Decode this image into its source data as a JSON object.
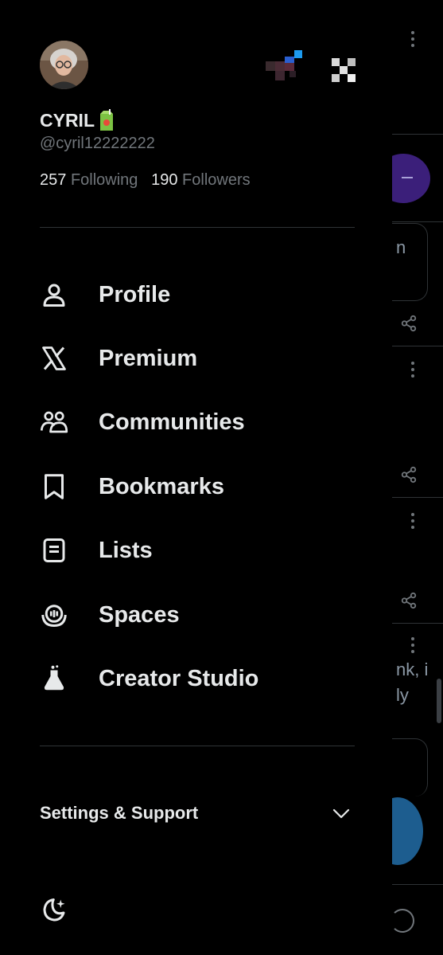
{
  "feed": {
    "fragments": [
      "n",
      "nk, i",
      "ly"
    ]
  },
  "profile": {
    "name": "CYRIL",
    "handle": "@cyril12222222",
    "following_count": "257",
    "following_label": "Following",
    "followers_count": "190",
    "followers_label": "Followers"
  },
  "nav": {
    "items": [
      {
        "label": "Profile",
        "icon": "person-icon"
      },
      {
        "label": "Premium",
        "icon": "x-logo-icon"
      },
      {
        "label": "Communities",
        "icon": "communities-icon"
      },
      {
        "label": "Bookmarks",
        "icon": "bookmark-icon"
      },
      {
        "label": "Lists",
        "icon": "list-icon"
      },
      {
        "label": "Spaces",
        "icon": "spaces-icon"
      },
      {
        "label": "Creator Studio",
        "icon": "flask-icon"
      }
    ]
  },
  "settings": {
    "label": "Settings & Support",
    "icon": "chevron-down-icon"
  },
  "footer": {
    "theme_icon": "moon-sparkle-icon"
  },
  "colors": {
    "background": "#000000",
    "text_primary": "#e7e9ea",
    "text_secondary": "#71767b",
    "divider": "#2f3336"
  }
}
